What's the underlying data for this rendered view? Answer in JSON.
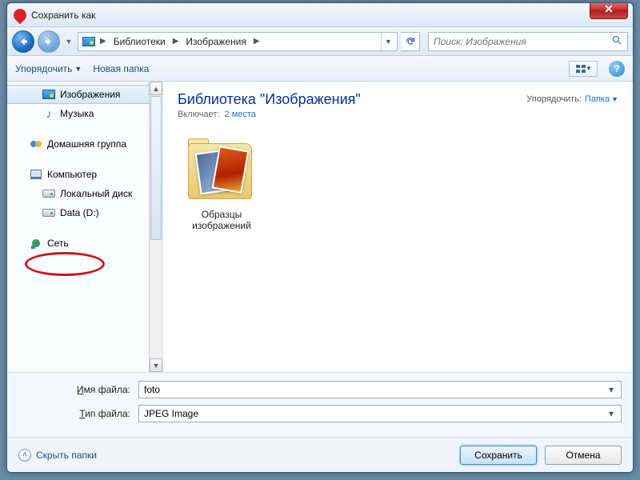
{
  "window": {
    "title": "Сохранить как"
  },
  "breadcrumb": {
    "seg1": "Библиотеки",
    "seg2": "Изображения"
  },
  "search": {
    "placeholder": "Поиск: Изображения"
  },
  "toolbar": {
    "organize": "Упорядочить",
    "new_folder": "Новая папка"
  },
  "sidebar": {
    "pictures": "Изображения",
    "music": "Музыка",
    "homegroup": "Домашняя группа",
    "computer": "Компьютер",
    "local_disk": "Локальный диск",
    "data_d": "Data (D:)",
    "network": "Сеть"
  },
  "content": {
    "lib_title": "Библиотека \"Изображения\"",
    "includes_label": "Включает:",
    "includes_link": "2 места",
    "arrange_label": "Упорядочить:",
    "arrange_value": "Папка",
    "folder_name_1": "Образцы",
    "folder_name_2": "изображений"
  },
  "fields": {
    "filename_label_pre": "И",
    "filename_label_post": "мя файла:",
    "filename_value": "foto",
    "filetype_label_pre": "Т",
    "filetype_label_post": "ип файла:",
    "filetype_value": "JPEG Image"
  },
  "footer": {
    "hide_folders": "Скрыть папки",
    "save": "Сохранить",
    "cancel": "Отмена"
  }
}
